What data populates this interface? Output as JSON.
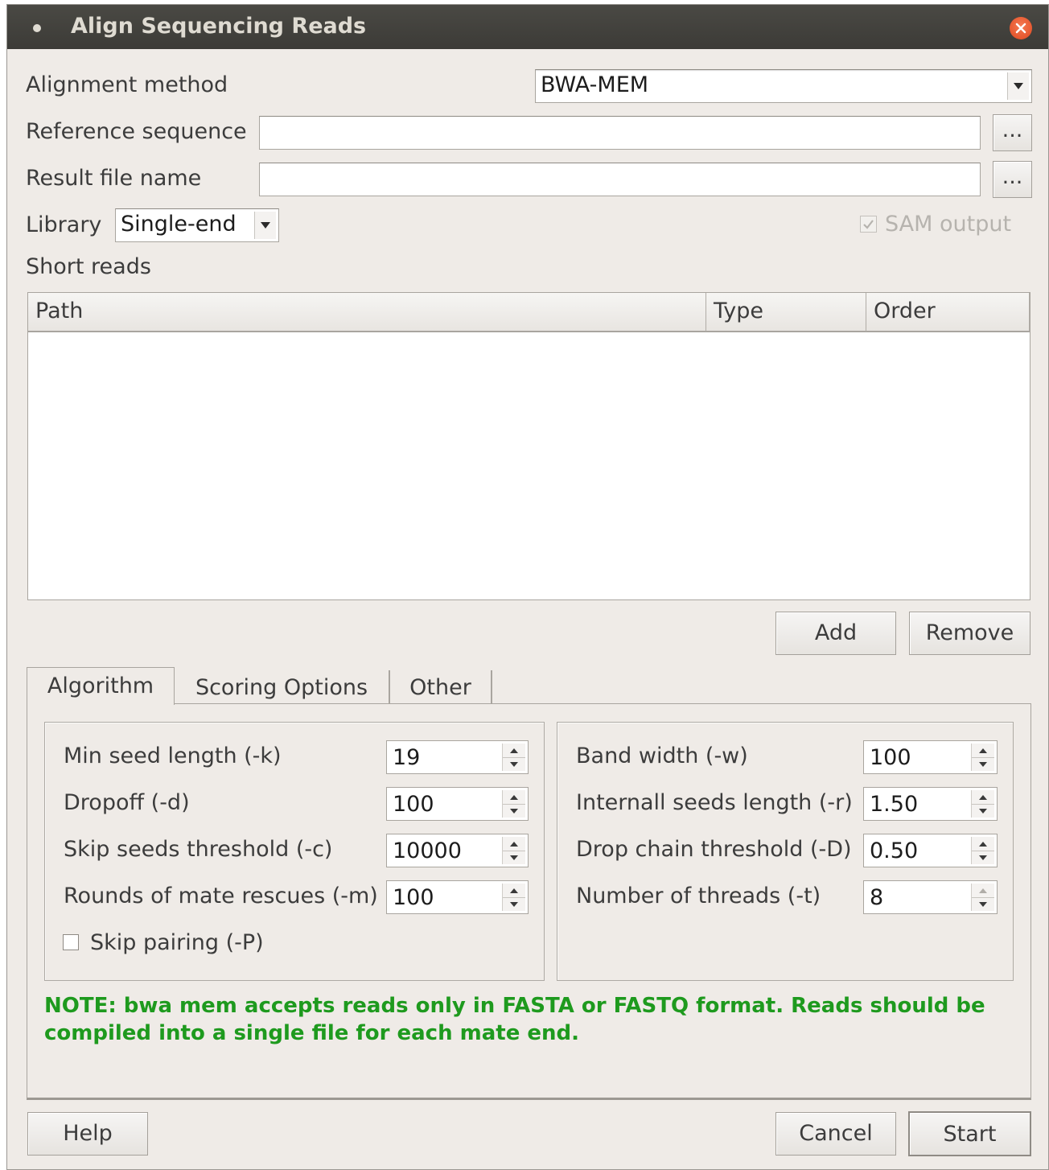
{
  "window": {
    "title": "Align Sequencing Reads",
    "close_icon": "close-icon"
  },
  "form": {
    "alignment_method_label": "Alignment method",
    "alignment_method_value": "BWA-MEM",
    "reference_label": "Reference sequence",
    "reference_value": "",
    "result_label": "Result file name",
    "result_value": "",
    "browse_label": "...",
    "library_label": "Library",
    "library_value": "Single-end",
    "sam_output_label": "SAM output",
    "sam_output_checked": true,
    "sam_output_enabled": false
  },
  "short_reads": {
    "label": "Short reads",
    "columns": [
      "Path",
      "Type",
      "Order"
    ],
    "rows": [],
    "add_label": "Add",
    "remove_label": "Remove"
  },
  "tabs": [
    {
      "label": "Algorithm",
      "active": true
    },
    {
      "label": "Scoring Options",
      "active": false
    },
    {
      "label": "Other",
      "active": false
    }
  ],
  "algorithm": {
    "left": [
      {
        "label": "Min seed length (-k)",
        "value": "19"
      },
      {
        "label": "Dropoff (-d)",
        "value": "100"
      },
      {
        "label": "Skip seeds threshold (-c)",
        "value": "10000"
      },
      {
        "label": "Rounds of mate rescues (-m)",
        "value": "100"
      }
    ],
    "skip_pairing_label": "Skip pairing (-P)",
    "skip_pairing_checked": false,
    "right": [
      {
        "label": "Band width (-w)",
        "value": "100"
      },
      {
        "label": "Internall seeds length (-r)",
        "value": "1.50"
      },
      {
        "label": "Drop chain threshold (-D)",
        "value": "0.50"
      },
      {
        "label": "Number of threads (-t)",
        "value": "8"
      }
    ]
  },
  "note": "NOTE: bwa mem accepts reads only in FASTA or FASTQ format. Reads should be compiled into a single file for each mate end.",
  "colors": {
    "note": "#1e9a1e",
    "close_button": "#e95420",
    "titlebar": "#3c3b37"
  },
  "footer": {
    "help_label": "Help",
    "cancel_label": "Cancel",
    "start_label": "Start"
  }
}
